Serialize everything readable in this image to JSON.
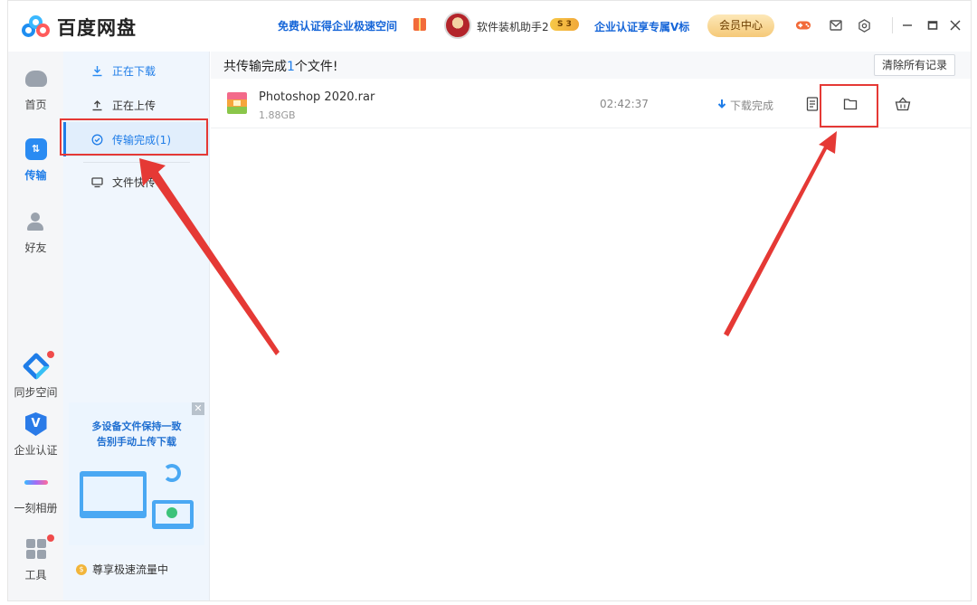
{
  "titlebar": {
    "app_name": "百度网盘",
    "promo_link": "免费认证得企业极速空间",
    "user_name": "软件装机助手2",
    "vip_badge": "S 3",
    "enterprise_link": "企业认证享专属V标",
    "member_center": "会员中心"
  },
  "leftnav": {
    "items": [
      {
        "label": "首页"
      },
      {
        "label": "传输"
      },
      {
        "label": "好友"
      },
      {
        "label": "同步空间"
      },
      {
        "label": "企业认证"
      },
      {
        "label": "一刻相册"
      },
      {
        "label": "工具"
      }
    ],
    "verify_letter": "V",
    "transfer_glyph": "⇅"
  },
  "subnav": {
    "items": [
      {
        "label": "正在下载"
      },
      {
        "label": "正在上传"
      },
      {
        "label": "传输完成(1)"
      },
      {
        "label": "文件快传"
      }
    ],
    "ad": {
      "line1": "多设备文件保持一致",
      "line2": "告别手动上传下载",
      "close": "✕"
    },
    "speed_text": "尊享极速流量中"
  },
  "main": {
    "summary_prefix": "共传输完成",
    "summary_count": "1",
    "summary_suffix": "个文件!",
    "clear_button": "清除所有记录",
    "files": [
      {
        "name": "Photoshop 2020.rar",
        "size": "1.88GB",
        "time": "02:42:37",
        "status": "下载完成"
      }
    ]
  },
  "colors": {
    "accent": "#1f7de8",
    "annotation_red": "#e53935"
  }
}
